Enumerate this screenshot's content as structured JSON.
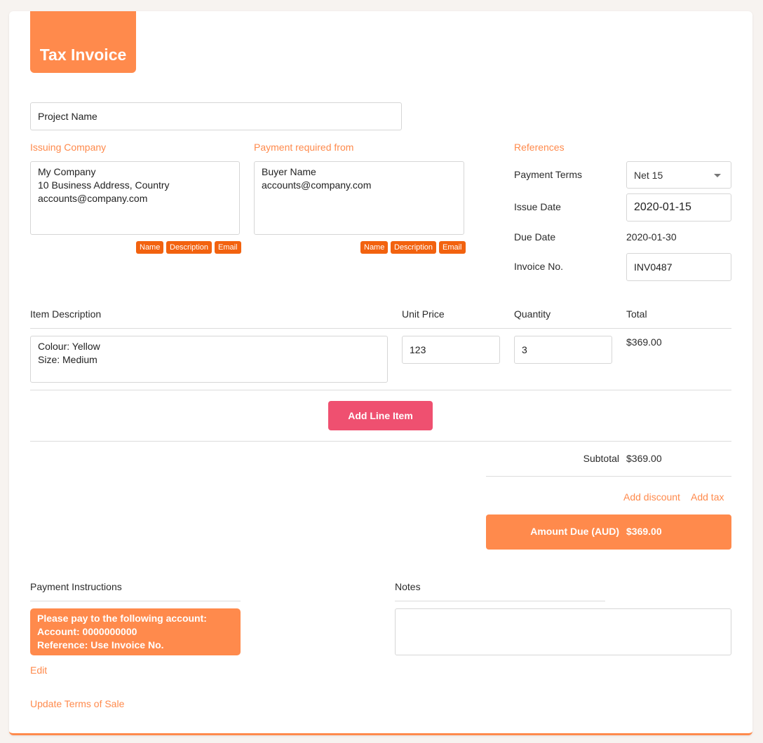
{
  "header": {
    "title": "Tax Invoice"
  },
  "project": {
    "name": "Project Name"
  },
  "issuing_company": {
    "label": "Issuing Company",
    "value": "My Company\n10 Business Address, Country\naccounts@company.com",
    "chips": [
      "Name",
      "Description",
      "Email"
    ]
  },
  "payment_from": {
    "label": "Payment required from",
    "value": "Buyer Name\naccounts@company.com",
    "chips": [
      "Name",
      "Description",
      "Email"
    ]
  },
  "references": {
    "label": "References",
    "payment_terms_label": "Payment Terms",
    "payment_terms_value": "Net 15",
    "issue_date_label": "Issue Date",
    "issue_date_value": "2020-01-15",
    "due_date_label": "Due Date",
    "due_date_value": "2020-01-30",
    "invoice_no_label": "Invoice No.",
    "invoice_no_value": "INV0487"
  },
  "items": {
    "headers": [
      "Item Description",
      "Unit Price",
      "Quantity",
      "Total"
    ],
    "rows": [
      {
        "description": "Colour: Yellow\nSize: Medium",
        "unit_price": "123",
        "quantity": "3",
        "total": "$369.00"
      }
    ],
    "add_label": "Add Line Item"
  },
  "totals": {
    "subtotal_label": "Subtotal",
    "subtotal_value": "$369.00",
    "add_discount": "Add discount",
    "add_tax": "Add tax",
    "amount_due_label": "Amount Due (AUD)",
    "amount_due_value": "$369.00"
  },
  "payment_instructions": {
    "label": "Payment Instructions",
    "text": "Please pay to the following account:\nAccount: 0000000000\nReference: Use Invoice No.",
    "edit": "Edit"
  },
  "notes": {
    "label": "Notes",
    "value": ""
  },
  "footer": {
    "update_terms": "Update Terms of Sale"
  },
  "colors": {
    "accent": "#ff8a4c",
    "chip": "#f2620f",
    "add_button": "#ef5070"
  }
}
